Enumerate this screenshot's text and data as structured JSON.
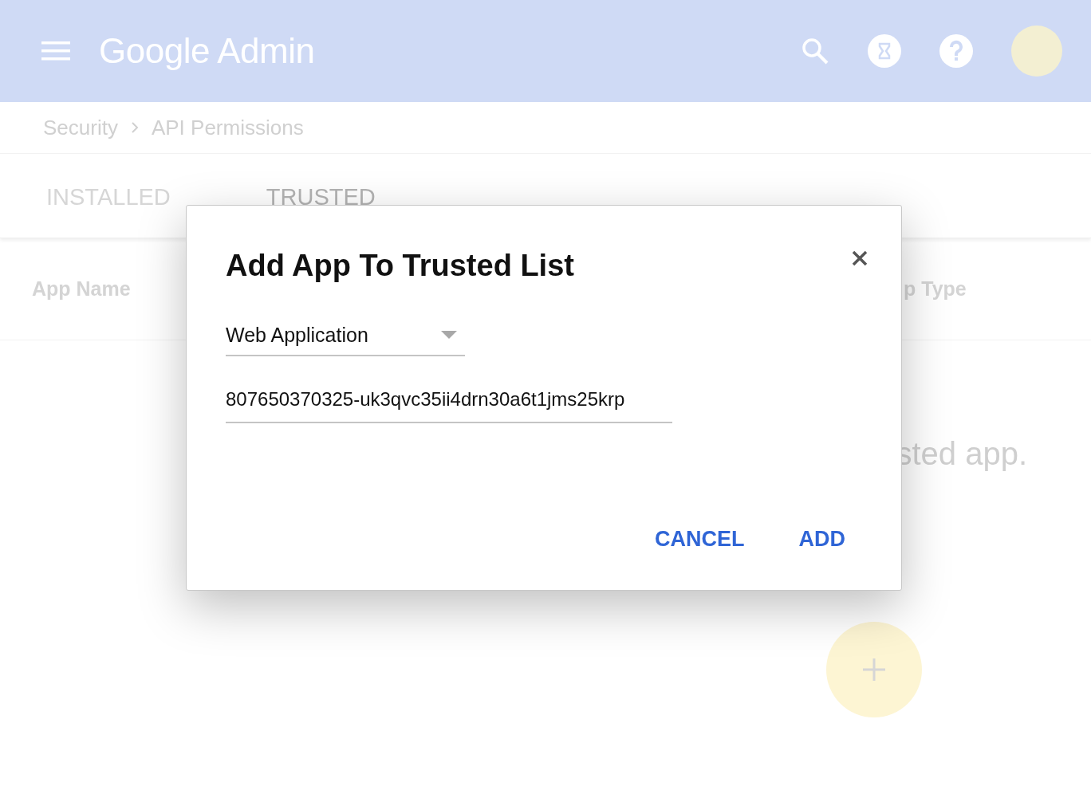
{
  "header": {
    "logo_text": "Google Admin"
  },
  "breadcrumb": [
    {
      "label": "Security"
    },
    {
      "label": "API Permissions"
    }
  ],
  "tabs": [
    {
      "label": "INSTALLED",
      "selected": false
    },
    {
      "label": "TRUSTED",
      "selected": true
    }
  ],
  "table": {
    "columns": [
      {
        "label": "App Name"
      },
      {
        "label": "p Type"
      }
    ],
    "empty_message": "sted app."
  },
  "dialog": {
    "title": "Add App To Trusted List",
    "app_type": {
      "value": "Web Application"
    },
    "client_id": {
      "value": "807650370325-uk3qvc35ii4drn30a6t1jms25krp"
    },
    "buttons": [
      {
        "label": "CANCEL"
      },
      {
        "label": "ADD"
      }
    ]
  }
}
